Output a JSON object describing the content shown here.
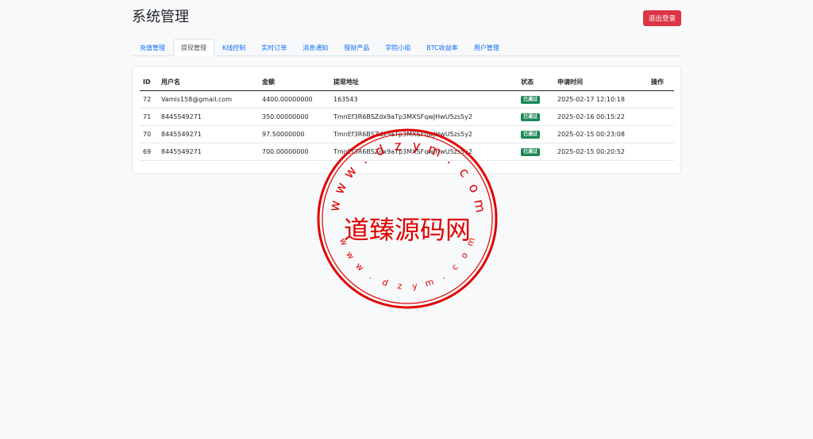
{
  "page": {
    "title": "系统管理",
    "logout_label": "退出登录"
  },
  "tabs": [
    {
      "label": "充值管理"
    },
    {
      "label": "提现管理",
      "active": true
    },
    {
      "label": "K线控制"
    },
    {
      "label": "实时订单"
    },
    {
      "label": "消息通知"
    },
    {
      "label": "理财产品"
    },
    {
      "label": "学院小组"
    },
    {
      "label": "BTC收益率"
    },
    {
      "label": "用户管理"
    }
  ],
  "table": {
    "headers": [
      "ID",
      "用户名",
      "金额",
      "提现地址",
      "状态",
      "申请时间",
      "操作"
    ],
    "rows": [
      {
        "id": "72",
        "user": "Vamis158@gmail.com",
        "amount": "4400.00000000",
        "address": "163543",
        "status": "已通过",
        "time": "2025-02-17 12:10:18"
      },
      {
        "id": "71",
        "user": "8445549271",
        "amount": "350.00000000",
        "address": "TmnEf3R6BSZdx9aTp3MXSFqwJHwU5zs5y2",
        "status": "已通过",
        "time": "2025-02-16 00:15:22"
      },
      {
        "id": "70",
        "user": "8445549271",
        "amount": "97.50000000",
        "address": "TmnEf3R6BSZdx9aTp3MXSFqwJHwU5zs5y2",
        "status": "已通过",
        "time": "2025-02-15 00:23:08"
      },
      {
        "id": "69",
        "user": "8445549271",
        "amount": "700.00000000",
        "address": "TmnEf3R6BSZdx9aTp3MXSFqwJHwU5zs5y2",
        "status": "已通过",
        "time": "2025-02-15 00:20:52"
      }
    ]
  },
  "watermark": {
    "text": "道臻源码网",
    "ring_text": "www.dzym.com",
    "color": "#e00000"
  },
  "colors": {
    "accent": "#0d6efd",
    "danger": "#dc3545",
    "success": "#198754"
  }
}
